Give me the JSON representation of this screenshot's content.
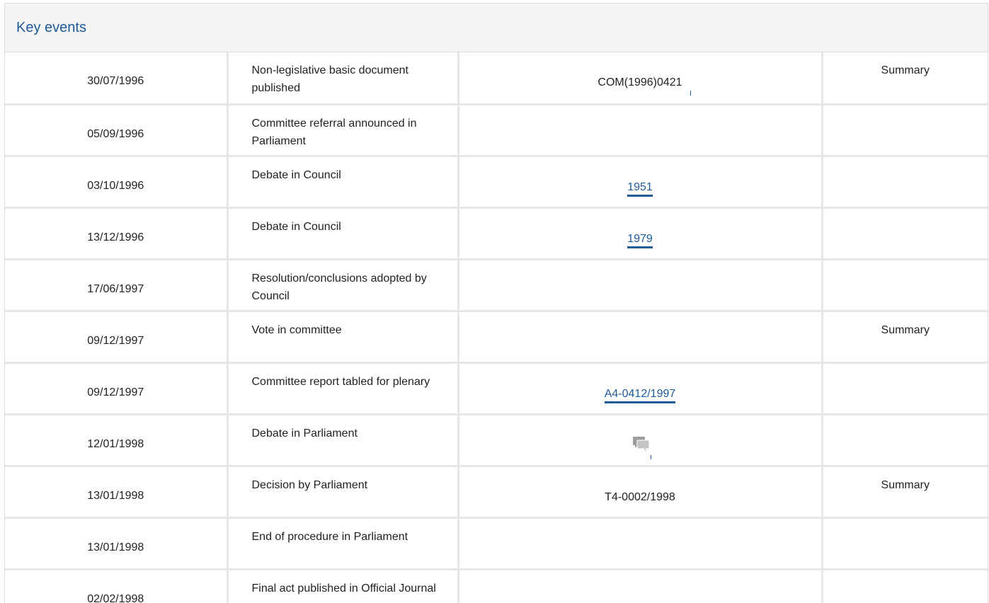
{
  "panel": {
    "title": "Key events"
  },
  "events": [
    {
      "date": "30/07/1996",
      "event": "Non-legislative basic document published",
      "doc": "COM(1996)0421",
      "summary": "Summary"
    },
    {
      "date": "05/09/1996",
      "event": "Committee referral announced in Parliament",
      "doc": "",
      "summary": ""
    },
    {
      "date": "03/10/1996",
      "event": "Debate in Council",
      "doc": "1951",
      "summary": ""
    },
    {
      "date": "13/12/1996",
      "event": "Debate in Council",
      "doc": "1979",
      "summary": ""
    },
    {
      "date": "17/06/1997",
      "event": "Resolution/conclusions adopted by Council",
      "doc": "",
      "summary": ""
    },
    {
      "date": "09/12/1997",
      "event": "Vote in committee",
      "doc": "",
      "summary": "Summary"
    },
    {
      "date": "09/12/1997",
      "event": "Committee report tabled for plenary",
      "doc": "A4-0412/1997",
      "summary": ""
    },
    {
      "date": "12/01/1998",
      "event": "Debate in Parliament",
      "doc_icon": "debate-speech-bubbles-icon",
      "summary": ""
    },
    {
      "date": "13/01/1998",
      "event": "Decision by Parliament",
      "doc": "T4-0002/1998",
      "summary": "Summary"
    },
    {
      "date": "13/01/1998",
      "event": "End of procedure in Parliament",
      "doc": "",
      "summary": ""
    },
    {
      "date": "02/02/1998",
      "event": "Final act published in Official Journal",
      "doc": "",
      "summary": ""
    }
  ],
  "colors": {
    "accent_link": "#1e5a9a",
    "header_bg": "#f4f4f4",
    "grid_line": "#e6e6e6"
  }
}
